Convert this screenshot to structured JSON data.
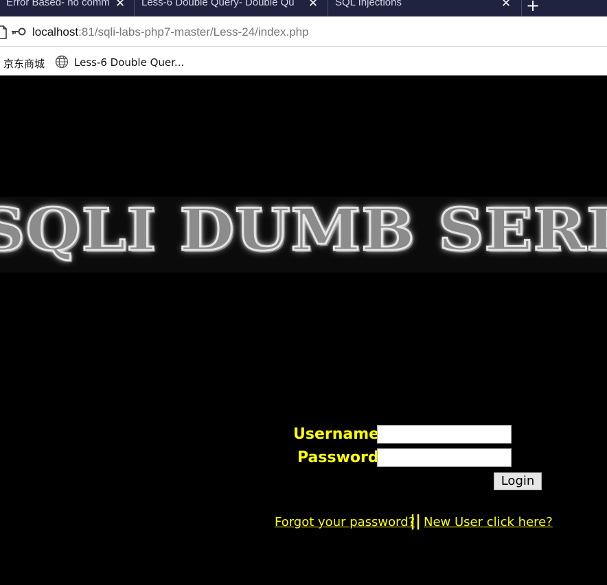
{
  "tabs": [
    {
      "title": "Error Based- no comm"
    },
    {
      "title": "Less-6 Double Query- Double Qu"
    },
    {
      "title": "SQL Injections"
    }
  ],
  "new_tab_label": "+",
  "close_glyph": "✕",
  "address": {
    "host": "localhost",
    "rest": ":81/sqli-labs-php7-master/Less-24/index.php"
  },
  "bookmarks": [
    {
      "label": "京东商城"
    },
    {
      "label": "Less-6 Double Quer..."
    }
  ],
  "banner": {
    "text": "SQLI DUMB SERIES"
  },
  "form": {
    "username_label": "Username:",
    "password_label": "Password:",
    "username_value": "",
    "password_value": "",
    "login_label": "Login"
  },
  "links": {
    "forgot": "Forgot your password?",
    "separator": "||",
    "new_user": "New User click here?"
  },
  "colors": {
    "accent": "#ffff00",
    "background": "#000000",
    "tabbar": "#202340"
  },
  "icons": [
    "page-icon",
    "key-icon",
    "globe-icon",
    "close-icon",
    "plus-icon"
  ]
}
